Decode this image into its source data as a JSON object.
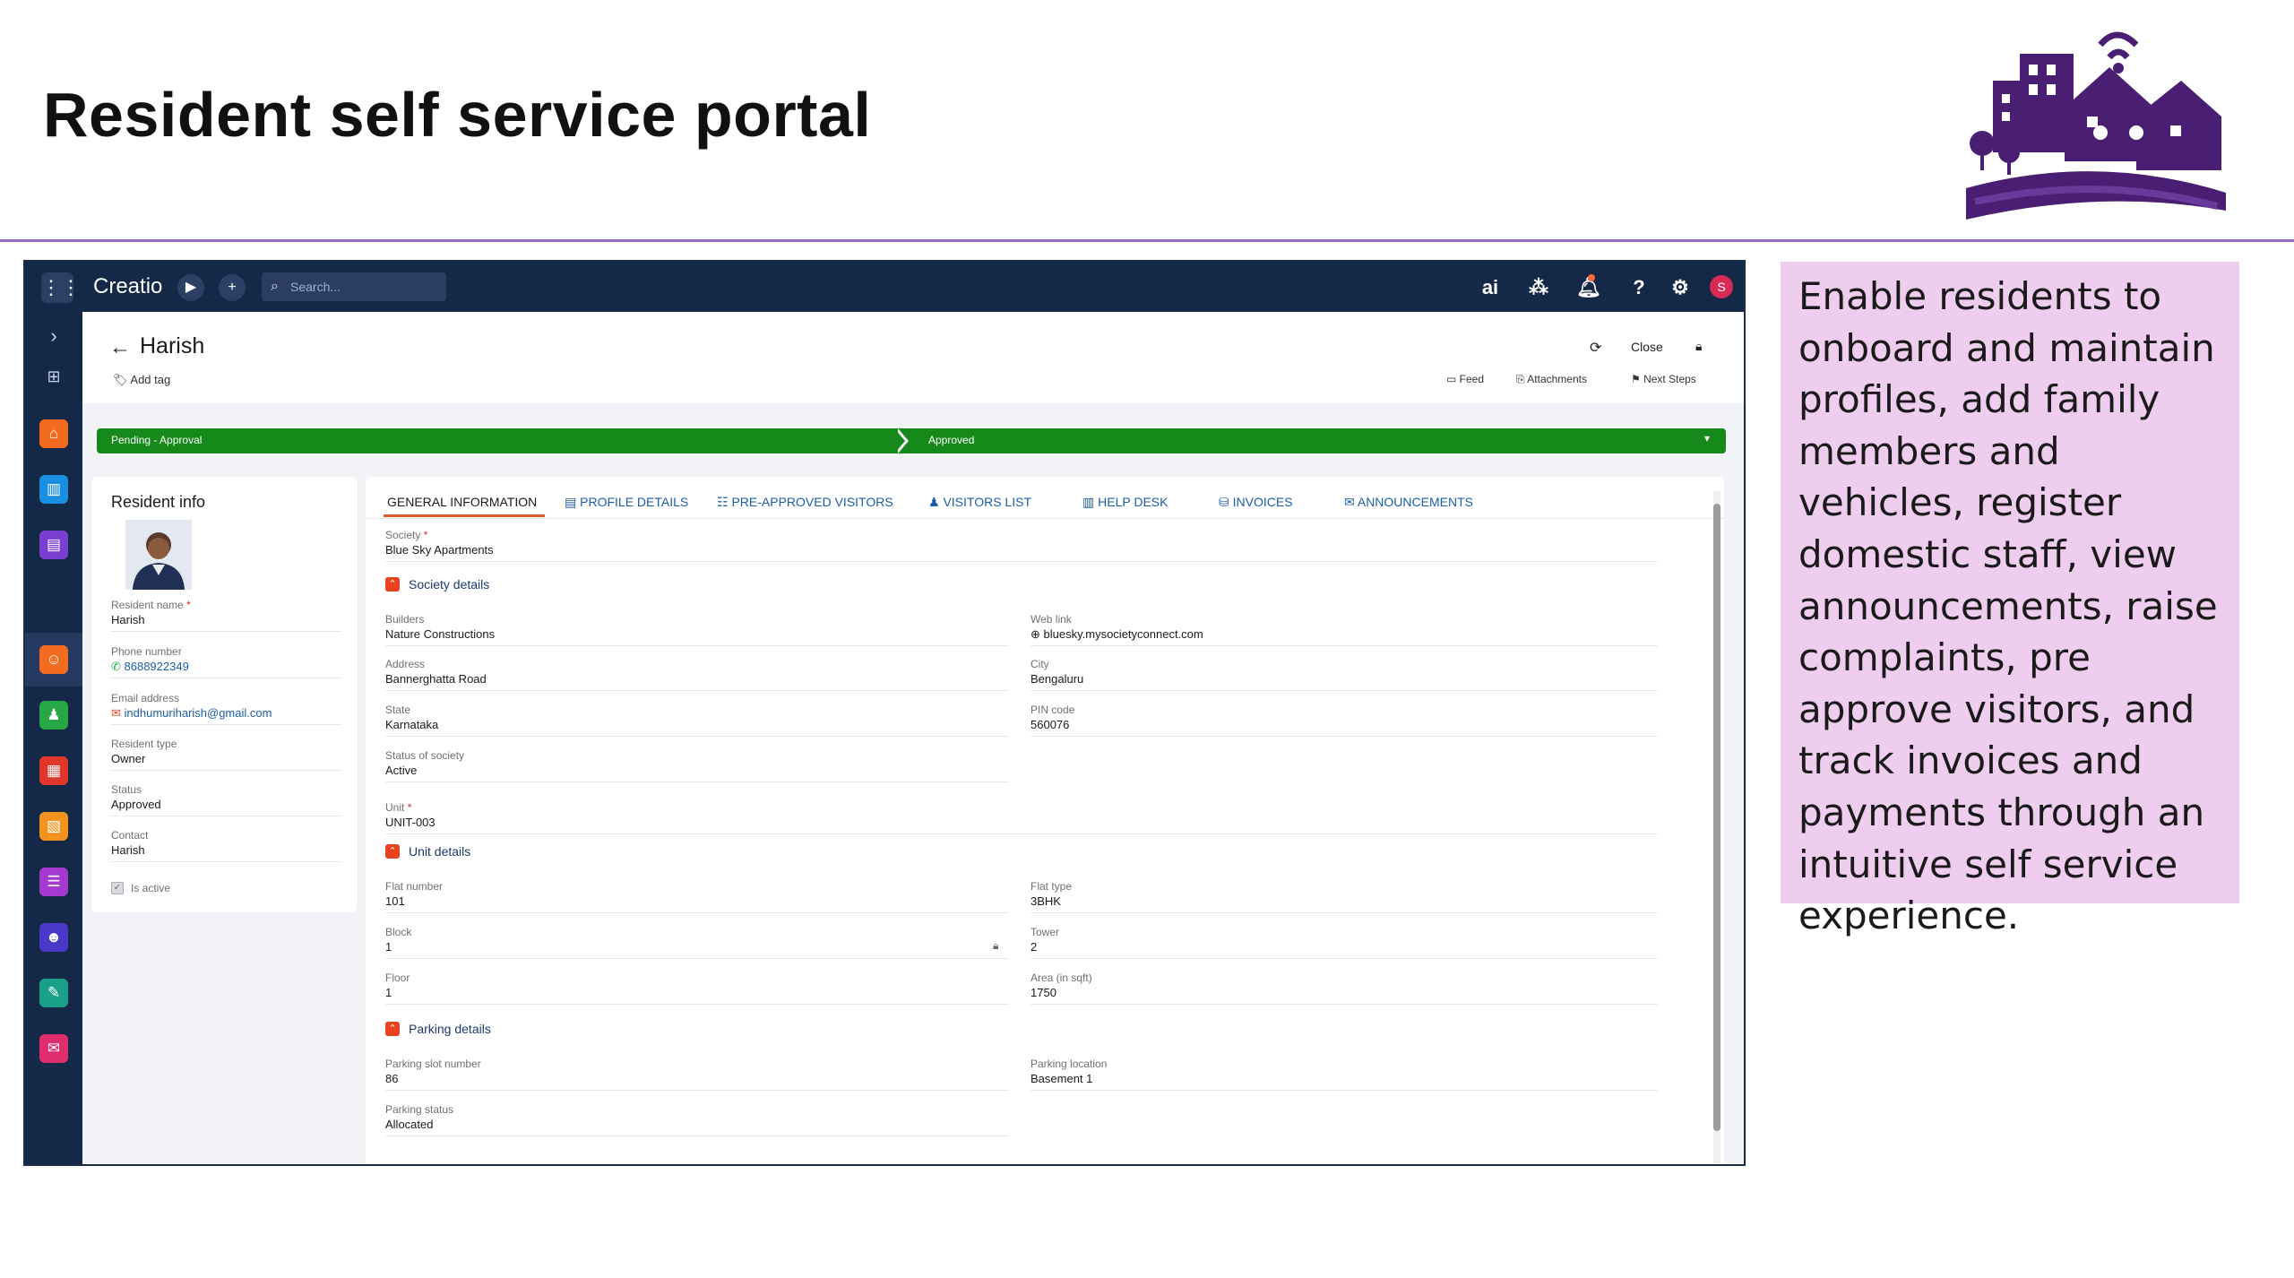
{
  "slide": {
    "title": "Resident self service portal",
    "description": "Enable residents to onboard and maintain profiles, add family members and vehicles, register domestic staff, view announcements, raise complaints, pre approve visitors, and track invoices and payments through an intuitive self service experience."
  },
  "topbar": {
    "brand": "Creatio",
    "search_placeholder": "Search...",
    "avatar_initial": "S",
    "icons": [
      "apps-grid-icon",
      "play-icon",
      "add-icon",
      "search-icon",
      "ai-icon",
      "apps-icon",
      "bell-icon",
      "help-icon",
      "settings-icon"
    ]
  },
  "record": {
    "title": "Harish",
    "add_tag": "Add tag",
    "actions": {
      "close": "Close",
      "feed": "Feed",
      "attachments": "Attachments",
      "next_steps": "Next Steps"
    }
  },
  "stages": {
    "current": "Pending - Approval",
    "next": "Approved",
    "color": "#15891a"
  },
  "resident_info": {
    "title": "Resident info",
    "fields": [
      {
        "label": "Resident name",
        "required": "*",
        "value": "Harish"
      },
      {
        "label": "Phone number",
        "value": "8688922349"
      },
      {
        "label": "Email address",
        "value": "indhumuriharish@gmail.com"
      },
      {
        "label": "Resident type",
        "value": "Owner"
      },
      {
        "label": "Status",
        "value": "Approved"
      },
      {
        "label": "Contact",
        "value": "Harish"
      }
    ],
    "is_active_label": "Is active"
  },
  "tabs": [
    {
      "label": "GENERAL INFORMATION",
      "active": true
    },
    {
      "label": "PROFILE DETAILS"
    },
    {
      "label": "PRE-APPROVED VISITORS"
    },
    {
      "label": "VISITORS LIST"
    },
    {
      "label": "HELP DESK"
    },
    {
      "label": "INVOICES"
    },
    {
      "label": "ANNOUNCEMENTS"
    }
  ],
  "general": {
    "society": {
      "label": "Society",
      "value": "Blue Sky Apartments"
    },
    "society_details": {
      "title": "Society details",
      "builders": {
        "label": "Builders",
        "value": "Nature Constructions"
      },
      "web_link": {
        "label": "Web link",
        "value": "bluesky.mysocietyconnect.com"
      },
      "address": {
        "label": "Address",
        "value": "Bannerghatta Road"
      },
      "city": {
        "label": "City",
        "value": "Bengaluru"
      },
      "state": {
        "label": "State",
        "value": "Karnataka"
      },
      "pin": {
        "label": "PIN code",
        "value": "560076"
      },
      "status": {
        "label": "Status of society",
        "value": "Active"
      }
    },
    "unit": {
      "label": "Unit",
      "value": "UNIT-003"
    },
    "unit_details": {
      "title": "Unit details",
      "flat_number": {
        "label": "Flat number",
        "value": "101"
      },
      "flat_type": {
        "label": "Flat type",
        "value": "3BHK"
      },
      "block": {
        "label": "Block",
        "value": "1"
      },
      "tower": {
        "label": "Tower",
        "value": "2"
      },
      "floor": {
        "label": "Floor",
        "value": "1"
      },
      "area": {
        "label": "Area (in sqft)",
        "value": "1750"
      }
    },
    "parking_details": {
      "title": "Parking details",
      "slot": {
        "label": "Parking slot number",
        "value": "86"
      },
      "location": {
        "label": "Parking location",
        "value": "Basement 1"
      },
      "status": {
        "label": "Parking status",
        "value": "Allocated"
      }
    }
  }
}
